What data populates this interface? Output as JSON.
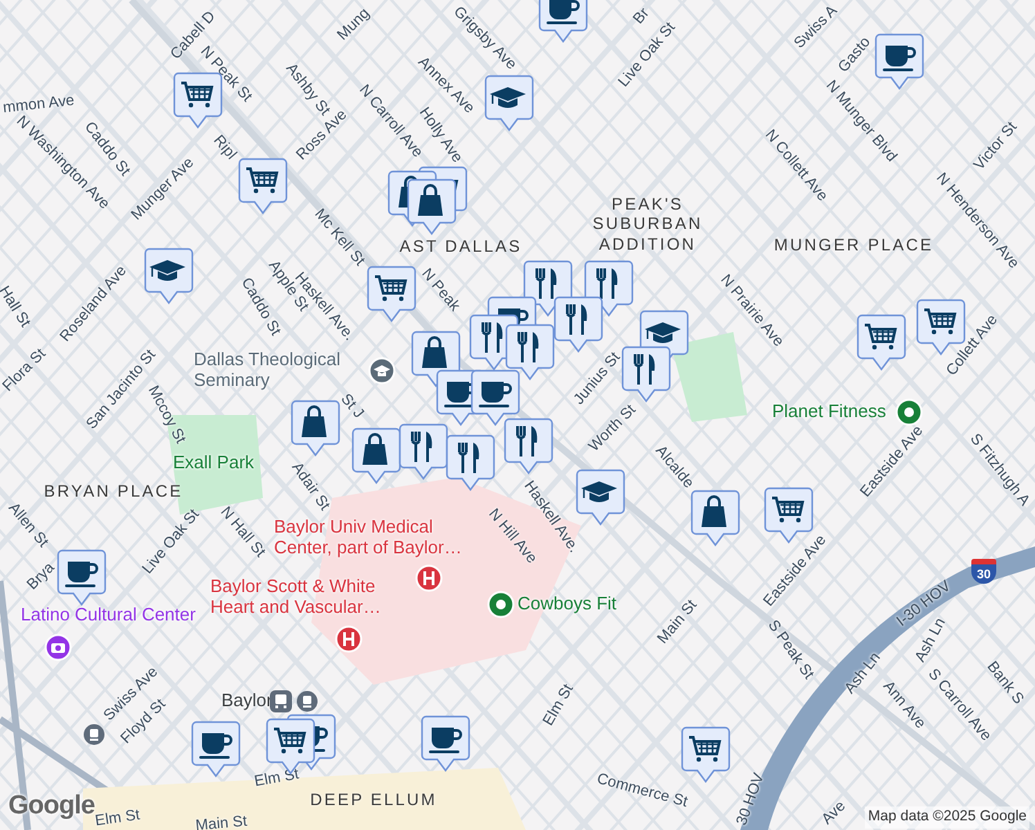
{
  "map": {
    "street_labels": [
      {
        "text": "Cabell D"
      },
      {
        "text": "N Peak St"
      },
      {
        "text": "Mung"
      },
      {
        "text": "Grigsby Ave"
      },
      {
        "text": "mmon Ave"
      },
      {
        "text": "Ashby St"
      },
      {
        "text": "Annex Ave"
      },
      {
        "text": "N Carroll Ave"
      },
      {
        "text": "Holly Ave"
      },
      {
        "text": "Ross Ave"
      },
      {
        "text": "Ripl"
      },
      {
        "text": "N Washington Ave"
      },
      {
        "text": "Caddo St"
      },
      {
        "text": "Munger Ave"
      },
      {
        "text": "Mc Kell St"
      },
      {
        "text": "Haskell Ave."
      },
      {
        "text": "N Peak"
      },
      {
        "text": "Apple St"
      },
      {
        "text": "Caddo St"
      },
      {
        "text": "Roseland Ave"
      },
      {
        "text": "Hall St"
      },
      {
        "text": "Flora St"
      },
      {
        "text": "San Jacinto St"
      },
      {
        "text": "Mccoy St"
      },
      {
        "text": "Br"
      },
      {
        "text": "Live Oak St"
      },
      {
        "text": "Swiss A"
      },
      {
        "text": "Gasto"
      },
      {
        "text": "N Munger Blvd"
      },
      {
        "text": "N Collett Ave"
      },
      {
        "text": "Victor St"
      },
      {
        "text": "N Henderson Ave"
      },
      {
        "text": "N Prairie Ave"
      },
      {
        "text": "Collett Ave"
      },
      {
        "text": "Junius St"
      },
      {
        "text": "Worth St"
      },
      {
        "text": "Alcalde"
      },
      {
        "text": "Haskell Ave."
      },
      {
        "text": "Eastside Ave"
      },
      {
        "text": "Eastside Ave"
      },
      {
        "text": "S Fitzhugh A"
      },
      {
        "text": "Main St"
      },
      {
        "text": "S Peak St"
      },
      {
        "text": "I-30 HOV"
      },
      {
        "text": "Ash Ln"
      },
      {
        "text": "Ash Ln"
      },
      {
        "text": "Ann Ave"
      },
      {
        "text": "S Carroll Ave"
      },
      {
        "text": "Bank S"
      },
      {
        "text": "Elm St"
      },
      {
        "text": "Commerce St"
      },
      {
        "text": "Ave"
      },
      {
        "text": "30 HOV"
      },
      {
        "text": "Adair St"
      },
      {
        "text": "St J"
      },
      {
        "text": "N Hill Ave"
      },
      {
        "text": "Allen St"
      },
      {
        "text": "Live Oak St"
      },
      {
        "text": "N Hall St"
      },
      {
        "text": "Brya"
      },
      {
        "text": "Swiss Ave"
      },
      {
        "text": "Floyd St"
      },
      {
        "text": "Elm St"
      },
      {
        "text": "Elm St"
      },
      {
        "text": "Main St"
      }
    ],
    "area_labels": [
      {
        "text": "AST DALLAS"
      },
      {
        "text": "PEAK'S SUBURBAN ADDITION"
      },
      {
        "text": "MUNGER PLACE"
      },
      {
        "text": "BRYAN PLACE"
      },
      {
        "text": "DEEP ELLUM"
      }
    ],
    "places": [
      {
        "name": "Dallas Theological Seminary",
        "kind": "school"
      },
      {
        "name": "Planet Fitness",
        "kind": "fitness"
      },
      {
        "name": "Exall Park",
        "kind": "park"
      },
      {
        "name": "Baylor Univ Medical Center, part of Baylor…",
        "kind": "hospital"
      },
      {
        "name": "Baylor Scott & White Heart and Vascular…",
        "kind": "hospital"
      },
      {
        "name": "Cowboys Fit",
        "kind": "fitness"
      },
      {
        "name": "Latino Cultural Center",
        "kind": "museum"
      },
      {
        "name": "Baylor",
        "kind": "station"
      }
    ],
    "shields": [
      {
        "text": "30"
      }
    ],
    "markers": [
      {
        "kind": "coffee"
      },
      {
        "kind": "cart"
      },
      {
        "kind": "school"
      },
      {
        "kind": "cart"
      },
      {
        "kind": "cart"
      },
      {
        "kind": "shopping"
      },
      {
        "kind": "shopping"
      },
      {
        "kind": "school"
      },
      {
        "kind": "cart"
      },
      {
        "kind": "coffee"
      },
      {
        "kind": "restaurant"
      },
      {
        "kind": "restaurant"
      },
      {
        "kind": "restaurant"
      },
      {
        "kind": "coffee"
      },
      {
        "kind": "restaurant"
      },
      {
        "kind": "restaurant"
      },
      {
        "kind": "shopping"
      },
      {
        "kind": "coffee"
      },
      {
        "kind": "coffee"
      },
      {
        "kind": "school"
      },
      {
        "kind": "restaurant"
      },
      {
        "kind": "cart"
      },
      {
        "kind": "cart"
      },
      {
        "kind": "shopping"
      },
      {
        "kind": "shopping"
      },
      {
        "kind": "restaurant"
      },
      {
        "kind": "restaurant"
      },
      {
        "kind": "restaurant"
      },
      {
        "kind": "school"
      },
      {
        "kind": "shopping"
      },
      {
        "kind": "cart"
      },
      {
        "kind": "coffee"
      },
      {
        "kind": "coffee"
      },
      {
        "kind": "coffee"
      },
      {
        "kind": "cart"
      },
      {
        "kind": "coffee"
      },
      {
        "kind": "cart"
      }
    ],
    "logo": "Google",
    "attribution": "Map data ©2025 Google"
  }
}
